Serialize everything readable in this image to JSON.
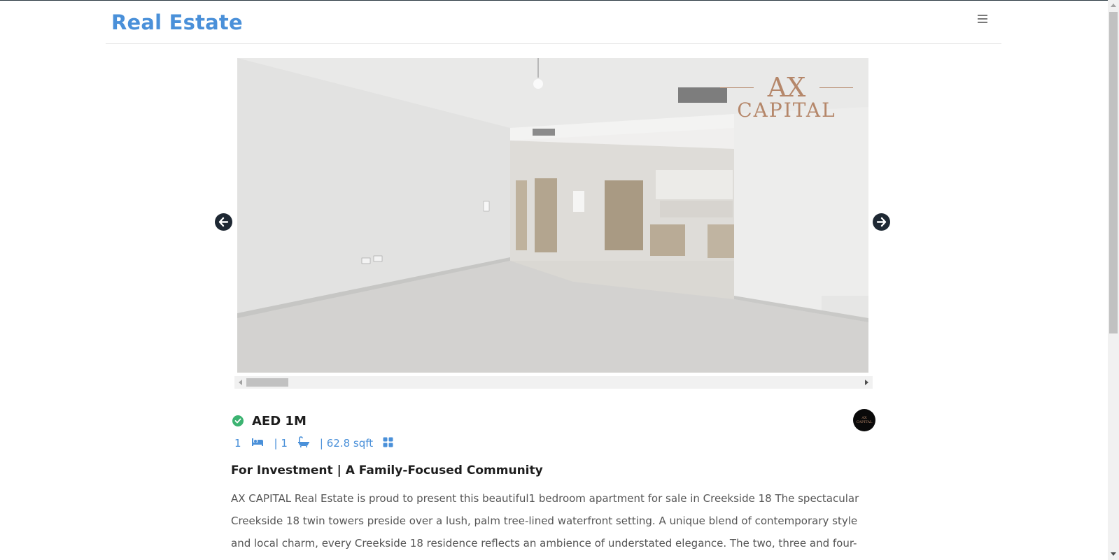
{
  "header": {
    "brand": "Real Estate",
    "menu_icon": "hamburger-icon"
  },
  "carousel": {
    "image_description_icon": "property-photo",
    "watermark": {
      "mark": "AX",
      "name": "CAPITAL"
    },
    "prev_icon": "arrow-left-icon",
    "next_icon": "arrow-right-icon"
  },
  "listing": {
    "verified_icon": "check-circle-icon",
    "price": "AED 1M",
    "agent_logo": {
      "mark": "AX",
      "name": "CAPITAL"
    },
    "features": {
      "bedrooms": "1",
      "bed_icon": "bed-icon",
      "bathrooms": "| 1",
      "bath_icon": "bath-icon",
      "area": "| 62.8 sqft",
      "grid_icon": "grid-icon"
    },
    "title": "For Investment | A Family-Focused Community",
    "description": "AX CAPITAL Real Estate is proud to present this beautiful1 bedroom apartment for sale in Creekside 18 The spectacular Creekside 18 twin towers preside over a lush, palm tree-lined waterfront setting. A unique blend of contemporary style and local charm, every Creekside 18 residence reflects an ambience of understated elegance. The two, three and four-bedroom luxury apartments"
  },
  "colors": {
    "brand": "#4a90d9",
    "verified": "#3cb371",
    "arrow_bg": "#1e2833",
    "logo_gold": "#b5876a"
  }
}
